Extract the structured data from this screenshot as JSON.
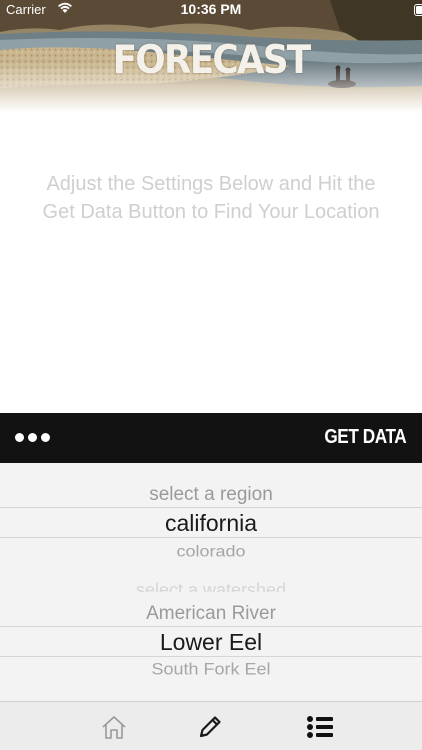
{
  "status_bar": {
    "carrier": "Carrier",
    "time": "10:36 PM",
    "wifi_icon": "wifi-icon",
    "battery_icon": "battery-icon"
  },
  "header": {
    "logo_text": "FORECAST"
  },
  "main": {
    "instructions": "Adjust the Settings Below and Hit the Get Data Button to Find Your Location"
  },
  "toolbar": {
    "more_icon": "more-dots-icon",
    "get_data_label": "GET DATA"
  },
  "region_picker": {
    "items": [
      "select a region",
      "california",
      "colorado"
    ],
    "selected": "california"
  },
  "watershed_picker": {
    "items": [
      "select a watershed",
      "American River",
      "Lower Eel",
      "South Fork Eel"
    ],
    "selected": "Lower Eel"
  },
  "tabbar": {
    "tabs": [
      {
        "icon": "home-icon",
        "active": false
      },
      {
        "icon": "pencil-icon",
        "active": false
      },
      {
        "icon": "list-icon",
        "active": true
      }
    ]
  },
  "colors": {
    "toolbar_bg": "#121212",
    "picker_bg": "#f3f3f3",
    "selected_text": "#1a1a1a",
    "faded_text": "#9a9a9a",
    "instruction_text": "#cfcfcf"
  }
}
